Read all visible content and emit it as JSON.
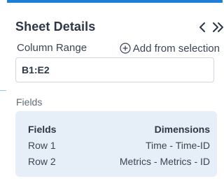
{
  "panel": {
    "title": "Sheet Details",
    "nav": {
      "prev_icon": "chevron-left-icon",
      "next_icon": "double-chevron-right-icon"
    },
    "column_range": {
      "label": "Column Range",
      "add_from_selection_label": "Add from selection",
      "value": "B1:E2"
    },
    "fields_heading": "Fields",
    "fields_table": {
      "headers": [
        "Fields",
        "Dimensions"
      ],
      "rows": [
        [
          "Row 1",
          "Time - Time-ID"
        ],
        [
          "Row 2",
          "Metrics - Metrics - ID"
        ]
      ]
    }
  },
  "colors": {
    "accent": "#1f7fd6",
    "card_bg": "#e6eef7"
  }
}
